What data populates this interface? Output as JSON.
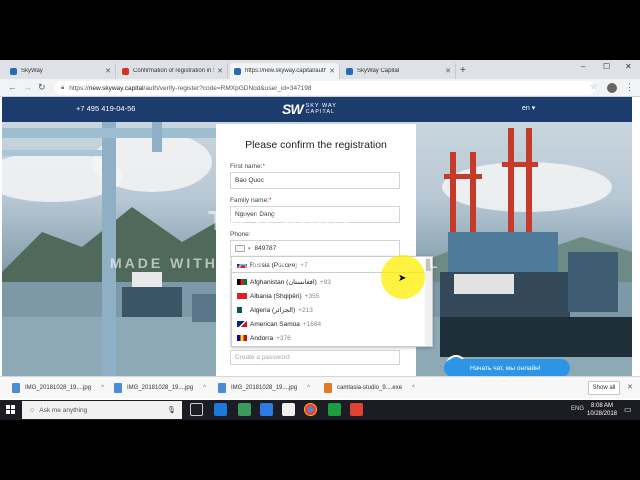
{
  "browser": {
    "tabs": [
      {
        "title": "SkyWay",
        "active": false,
        "favicon_color": "#2b6cb0"
      },
      {
        "title": "Confirmation of registration in SkyWay",
        "active": false,
        "favicon_color": "#d93025"
      },
      {
        "title": "https://new.skyway.capital/auth",
        "active": true,
        "favicon_color": "#2b6cb0"
      },
      {
        "title": "SkyWay Capital",
        "active": false,
        "favicon_color": "#2b6cb0"
      }
    ],
    "new_tab": "+",
    "window_controls": [
      "–",
      "☐",
      "✕"
    ],
    "url_scheme": "https://",
    "url_host": "new.skyway.capital",
    "url_path": "/auth/verify-register?code=RMXpGDNod&user_id=347198"
  },
  "site": {
    "phone": "+7 495 419-04-56",
    "logo_mark": "SW",
    "logo_line1": "SKY WAY",
    "logo_line2": "CAPITAL",
    "language": "en ▾"
  },
  "form": {
    "title": "Please confirm the registration",
    "first_name_label": "First name:",
    "first_name_value": "Bao Quoc",
    "family_name_label": "Family name:",
    "family_name_value": "Nguyen Dang",
    "phone_label": "Phone:",
    "phone_value": "849787",
    "password_placeholder": "Create a password",
    "required_mark": "*"
  },
  "country_dropdown": [
    {
      "name": "Russia (Россия)",
      "code": "+7",
      "flag": "#d52b1e"
    },
    {
      "name": "Afghanistan (افغانستان)",
      "code": "+93",
      "flag": "#007a36"
    },
    {
      "name": "Albania (Shqipëri)",
      "code": "+355",
      "flag": "#e41e20"
    },
    {
      "name": "Algeria (الجزائر)",
      "code": "+213",
      "flag": "#006233"
    },
    {
      "name": "American Samoa",
      "code": "+1684",
      "flag": "#002b7f"
    },
    {
      "name": "Andorra",
      "code": "+376",
      "flag": "#fedf00"
    }
  ],
  "watermark": {
    "line1": "TechSmith",
    "line2": "MADE WITH CAMTASIA FREE TRIAL"
  },
  "chat": {
    "label": "Начать чат, мы онлайн!"
  },
  "downloads": [
    {
      "name": "IMG_20181028_19....jpg",
      "type": "jpg"
    },
    {
      "name": "IMG_20181028_19....jpg",
      "type": "jpg"
    },
    {
      "name": "IMG_20181028_19....jpg",
      "type": "jpg"
    },
    {
      "name": "camtasia-studio_9....exe",
      "type": "exe"
    }
  ],
  "downloads_show_all": "Show all",
  "taskbar": {
    "search_placeholder": "Ask me anything",
    "language": "ENG",
    "time": "8:08 AM",
    "date": "10/28/2018"
  }
}
